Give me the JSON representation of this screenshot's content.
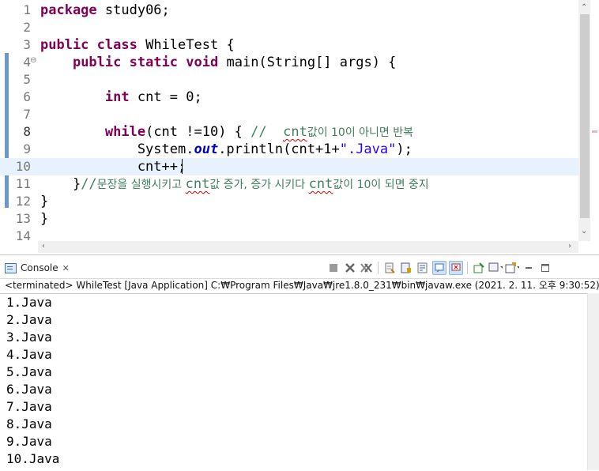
{
  "editor": {
    "lines": [
      {
        "num": "1",
        "segments": [
          {
            "c": "kw",
            "t": "package"
          },
          {
            "c": "var",
            "t": " study06;"
          }
        ]
      },
      {
        "num": "2",
        "segments": []
      },
      {
        "num": "3",
        "segments": [
          {
            "c": "kw",
            "t": "public"
          },
          {
            "c": "var",
            "t": " "
          },
          {
            "c": "kw",
            "t": "class"
          },
          {
            "c": "var",
            "t": " WhileTest {"
          }
        ]
      },
      {
        "num": "4",
        "segments": [
          {
            "c": "var",
            "t": "    "
          },
          {
            "c": "kw",
            "t": "public"
          },
          {
            "c": "var",
            "t": " "
          },
          {
            "c": "kw",
            "t": "static"
          },
          {
            "c": "var",
            "t": " "
          },
          {
            "c": "kw",
            "t": "void"
          },
          {
            "c": "var",
            "t": " main(String[] args) {"
          }
        ]
      },
      {
        "num": "5",
        "segments": []
      },
      {
        "num": "6",
        "segments": [
          {
            "c": "var",
            "t": "        "
          },
          {
            "c": "kw",
            "t": "int"
          },
          {
            "c": "var",
            "t": " cnt = 0;"
          }
        ]
      },
      {
        "num": "7",
        "segments": []
      },
      {
        "num": "8",
        "segments": [
          {
            "c": "var",
            "t": "        "
          },
          {
            "c": "kw",
            "t": "while"
          },
          {
            "c": "var",
            "t": "(cnt !=10) { "
          },
          {
            "c": "cmt",
            "t": "//  "
          },
          {
            "c": "cmt squig",
            "t": "cnt"
          },
          {
            "c": "cmt ko",
            "t": "값이 10이 아니면 반복"
          }
        ]
      },
      {
        "num": "9",
        "segments": [
          {
            "c": "var",
            "t": "            System."
          },
          {
            "c": "fld",
            "t": "out"
          },
          {
            "c": "var",
            "t": ".println(cnt+1+"
          },
          {
            "c": "str",
            "t": "\".Java\""
          },
          {
            "c": "var",
            "t": ");"
          }
        ]
      },
      {
        "num": "10",
        "segments": [
          {
            "c": "var",
            "t": "            cnt++;"
          }
        ]
      },
      {
        "num": "11",
        "segments": [
          {
            "c": "var",
            "t": "    }"
          },
          {
            "c": "cmt",
            "t": "//"
          },
          {
            "c": "cmt ko",
            "t": "문장을 실행시키고 "
          },
          {
            "c": "cmt squig",
            "t": "cnt"
          },
          {
            "c": "cmt ko",
            "t": "값 증가, 증가 시키다 "
          },
          {
            "c": "cmt squig",
            "t": "cnt"
          },
          {
            "c": "cmt ko",
            "t": "값이 10이 되면 중지"
          }
        ]
      },
      {
        "num": "12",
        "segments": [
          {
            "c": "var",
            "t": "}"
          }
        ]
      },
      {
        "num": "13",
        "segments": [
          {
            "c": "var",
            "t": "}"
          }
        ]
      },
      {
        "num": "14",
        "segments": []
      }
    ],
    "current_line": 10,
    "fold_marker": "⊖"
  },
  "console": {
    "tab_label": "Console",
    "tab_close": "✕",
    "status": "<terminated> WhileTest [Java Application] C:₩Program Files₩Java₩jre1.8.0_231₩bin₩javaw.exe (2021. 2. 11. 오후 9:30:52)",
    "output": [
      "1.Java",
      "2.Java",
      "3.Java",
      "4.Java",
      "5.Java",
      "6.Java",
      "7.Java",
      "8.Java",
      "9.Java",
      "10.Java"
    ]
  },
  "toolbar": {
    "icons": [
      "terminate-icon",
      "remove-launch-icon",
      "remove-all-icon",
      "clear-console-icon",
      "scroll-lock-icon",
      "word-wrap-icon",
      "show-on-stdout-icon",
      "show-on-stderr-icon",
      "pin-console-icon",
      "display-console-icon",
      "open-console-icon",
      "minimize-icon",
      "maximize-icon"
    ]
  },
  "colors": {
    "keyword": "#7f0055",
    "string": "#2a00ff",
    "comment": "#3f7f5f",
    "field": "#0000c0",
    "current_line": "#e8f2fe",
    "change_bar": "#6b9ac9"
  }
}
